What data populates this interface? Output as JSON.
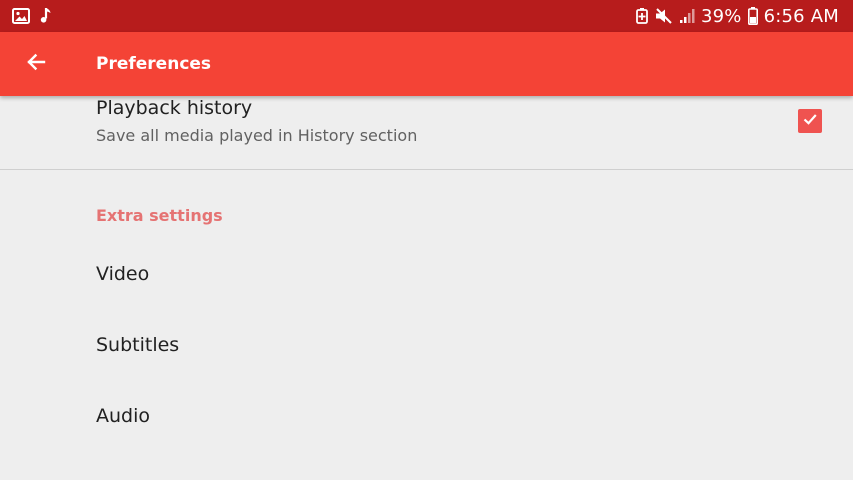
{
  "status_bar": {
    "left_icons": [
      "image-icon",
      "music-note-icon"
    ],
    "right_icons": [
      "battery-saver-icon",
      "mute-icon",
      "signal-icon",
      "battery-icon"
    ],
    "battery": "39%",
    "time": "6:56 AM"
  },
  "app_bar": {
    "back_icon": "arrow-back-icon",
    "title": "Preferences",
    "color": "#f44336"
  },
  "preferences": {
    "playback_history": {
      "title": "Playback history",
      "summary": "Save all media played in History section",
      "checked": true
    },
    "extra_settings": {
      "header": "Extra settings",
      "items": [
        {
          "label": "Video"
        },
        {
          "label": "Subtitles"
        },
        {
          "label": "Audio"
        }
      ]
    }
  },
  "colors": {
    "status_bar": "#b71c1c",
    "accent": "#ef5350",
    "section_header": "#e57373",
    "background": "#eeeeee"
  }
}
